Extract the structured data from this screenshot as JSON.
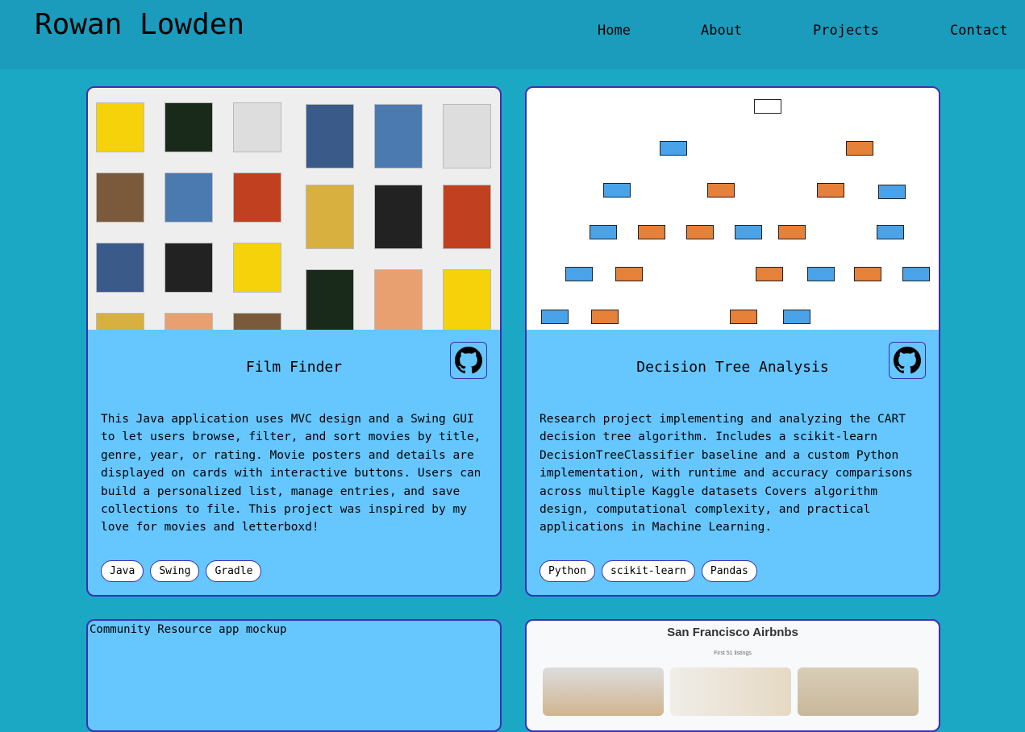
{
  "header": {
    "name": "Rowan Lowden",
    "nav": [
      "Home",
      "About",
      "Projects",
      "Contact"
    ]
  },
  "projects": [
    {
      "title": "Film Finder",
      "description": "This Java application uses MVC design and a Swing GUI to let users browse, filter, and sort movies by title, genre, year, or rating. Movie posters and details are displayed on cards with interactive buttons. Users can build a personalized list, manage entries, and save collections to file. This project was inspired by my love for movies and letterboxd!",
      "tags": [
        "Java",
        "Swing",
        "Gradle"
      ],
      "image": "Film Finder app screenshot"
    },
    {
      "title": "Decision Tree Analysis",
      "description": "Research project implementing and analyzing the CART decision tree algorithm. Includes a scikit-learn DecisionTreeClassifier baseline and a custom Python implementation, with runtime and accuracy comparisons across multiple Kaggle datasets Covers algorithm design, computational complexity, and practical applications in Machine Learning.",
      "tags": [
        "Python",
        "scikit-learn",
        "Pandas"
      ],
      "image": "Decision tree plot"
    },
    {
      "alt": "Community Resource app mockup"
    },
    {
      "image_title": "San Francisco Airbnbs",
      "image_subtitle": "First 51 listings"
    }
  ],
  "colors": {
    "header": "#1b9cbd",
    "background": "#1ba8c4",
    "card": "#66c6fe",
    "border": "#3b2fb5",
    "leaf_blue": "#4aa3e8",
    "leaf_orange": "#e58139"
  }
}
